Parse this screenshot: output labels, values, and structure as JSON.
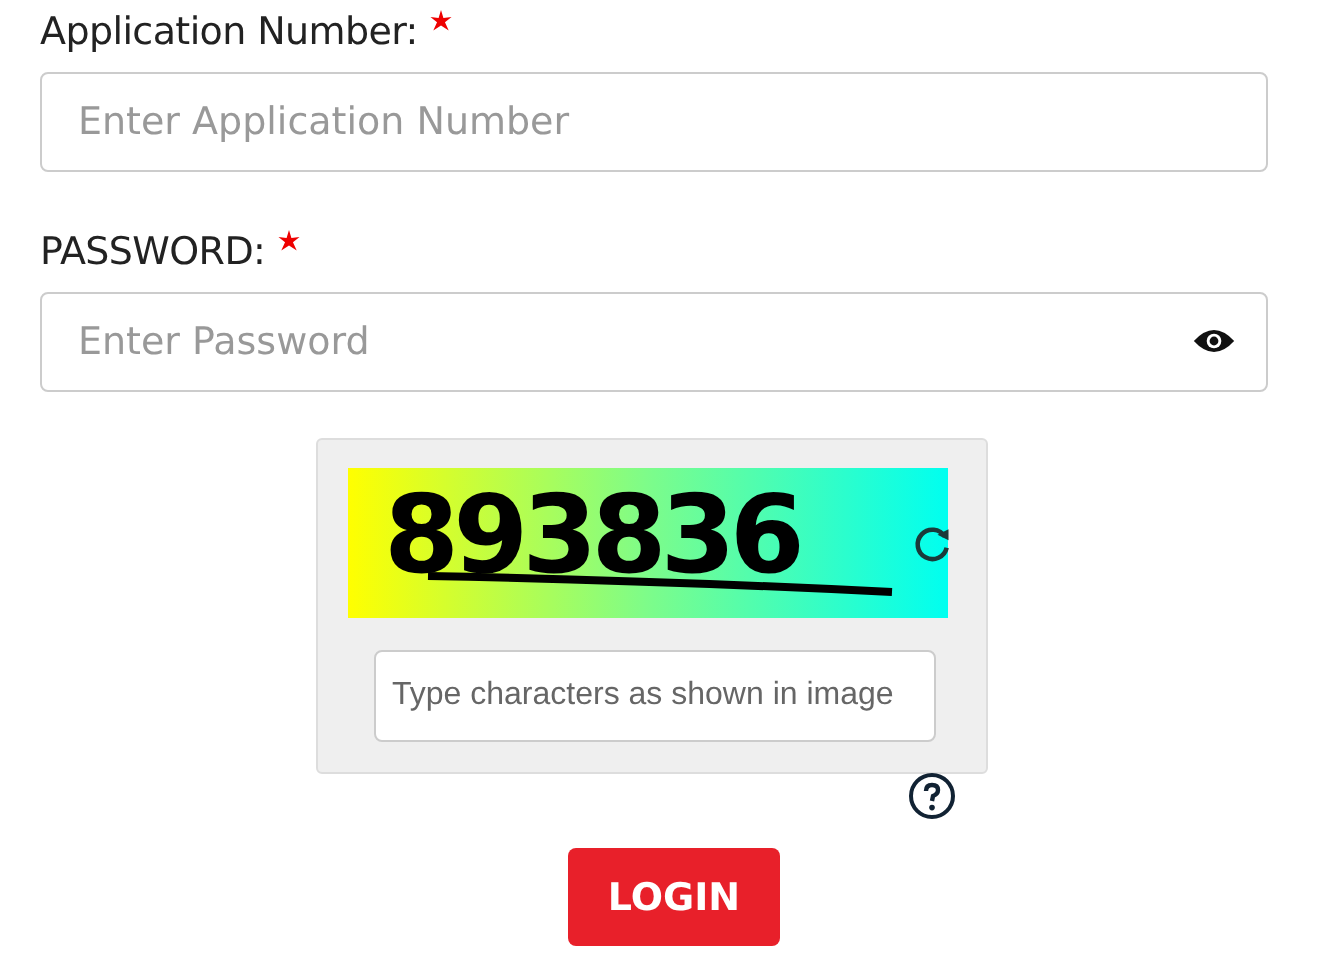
{
  "fields": [
    {
      "label": "Application Number:",
      "required": true,
      "placeholder": "Enter Application Number",
      "kind": "text"
    },
    {
      "label": "PASSWORD:",
      "required": true,
      "placeholder": "Enter Password",
      "kind": "password"
    }
  ],
  "captcha": {
    "text": "893836",
    "placeholder": "Type characters as shown in image"
  },
  "button": "LOGIN"
}
